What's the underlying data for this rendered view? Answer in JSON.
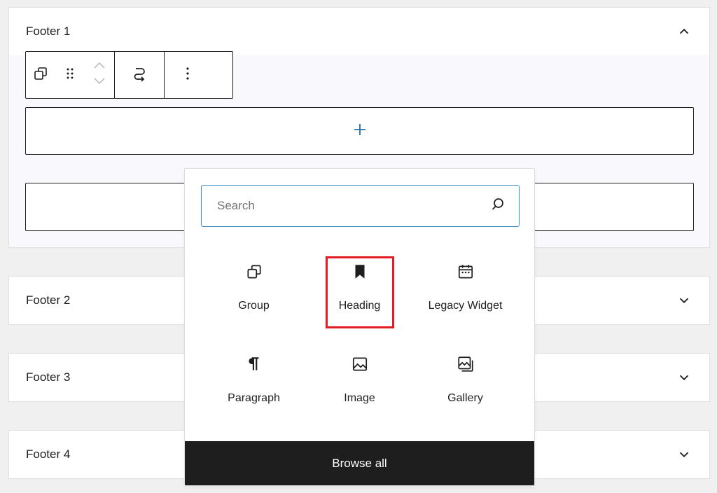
{
  "panels": [
    {
      "title": "Footer 1",
      "expanded": true
    },
    {
      "title": "Footer 2",
      "expanded": false
    },
    {
      "title": "Footer 3",
      "expanded": false
    },
    {
      "title": "Footer 4",
      "expanded": false
    }
  ],
  "toolbar": {
    "icons": [
      "group-icon",
      "drag-handle-icon",
      "move-up-icon",
      "move-down-icon",
      "transform-icon",
      "more-options-icon"
    ]
  },
  "appender": {
    "icon": "plus-icon"
  },
  "inserter": {
    "search_placeholder": "Search",
    "blocks": [
      {
        "label": "Group",
        "icon": "group-icon"
      },
      {
        "label": "Heading",
        "icon": "bookmark-icon"
      },
      {
        "label": "Legacy Widget",
        "icon": "calendar-icon"
      },
      {
        "label": "Paragraph",
        "icon": "pilcrow-icon"
      },
      {
        "label": "Image",
        "icon": "image-icon"
      },
      {
        "label": "Gallery",
        "icon": "gallery-icon"
      }
    ],
    "highlighted_block": "Heading",
    "browse_all_label": "Browse all"
  },
  "colors": {
    "accent": "#3c8fc9",
    "plus": "#2271b1",
    "highlight": "#e31b23",
    "dark": "#1e1e1e"
  }
}
